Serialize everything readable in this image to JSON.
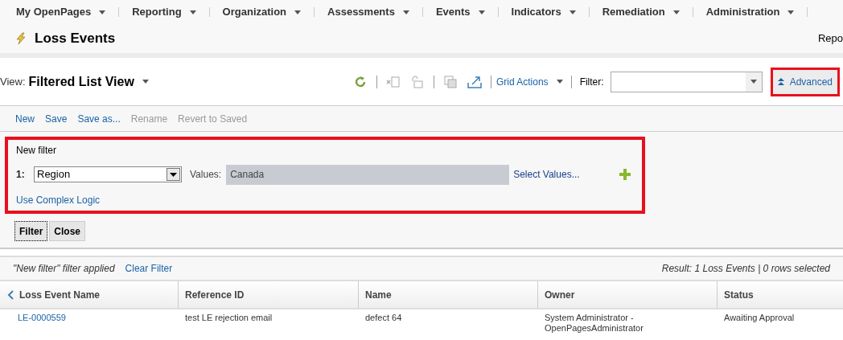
{
  "nav": {
    "items": [
      {
        "label": "My OpenPages"
      },
      {
        "label": "Reporting"
      },
      {
        "label": "Organization"
      },
      {
        "label": "Assessments"
      },
      {
        "label": "Events"
      },
      {
        "label": "Indicators"
      },
      {
        "label": "Remediation"
      },
      {
        "label": "Administration"
      }
    ]
  },
  "page": {
    "title": "Loss Events",
    "right_link": "Repo"
  },
  "view_bar": {
    "label": "View:",
    "view_name": "Filtered List View",
    "grid_actions": "Grid Actions",
    "filter_label": "Filter:",
    "advanced": {
      "label": "Advanced",
      "highlighted": true
    }
  },
  "filter_actions": [
    {
      "label": "New",
      "disabled": false
    },
    {
      "label": "Save",
      "disabled": false
    },
    {
      "label": "Save as...",
      "disabled": false
    },
    {
      "label": "Rename",
      "disabled": true
    },
    {
      "label": "Revert to Saved",
      "disabled": true
    }
  ],
  "filter_panel": {
    "highlighted": true,
    "title": "New filter",
    "rows": [
      {
        "number": "1:",
        "field": "Region",
        "values_label": "Values:",
        "values": "Canada",
        "select_values": "Select Values..."
      }
    ],
    "complex_logic": "Use Complex Logic"
  },
  "buttons": [
    {
      "label": "Filter",
      "focused": true
    },
    {
      "label": "Close",
      "focused": false
    }
  ],
  "result_bar": {
    "applied": "\"New filter\" filter applied",
    "clear": "Clear Filter",
    "result": "Result: 1 Loss Events | 0 rows selected"
  },
  "table": {
    "columns": [
      "Loss Event Name",
      "Reference ID",
      "Name",
      "Owner",
      "Status"
    ],
    "rows": [
      {
        "cells": [
          "LE-0000559",
          "test LE rejection email",
          "defect 64",
          "System Administrator - OpenPagesAdministrator",
          "Awaiting Approval"
        ]
      }
    ]
  }
}
